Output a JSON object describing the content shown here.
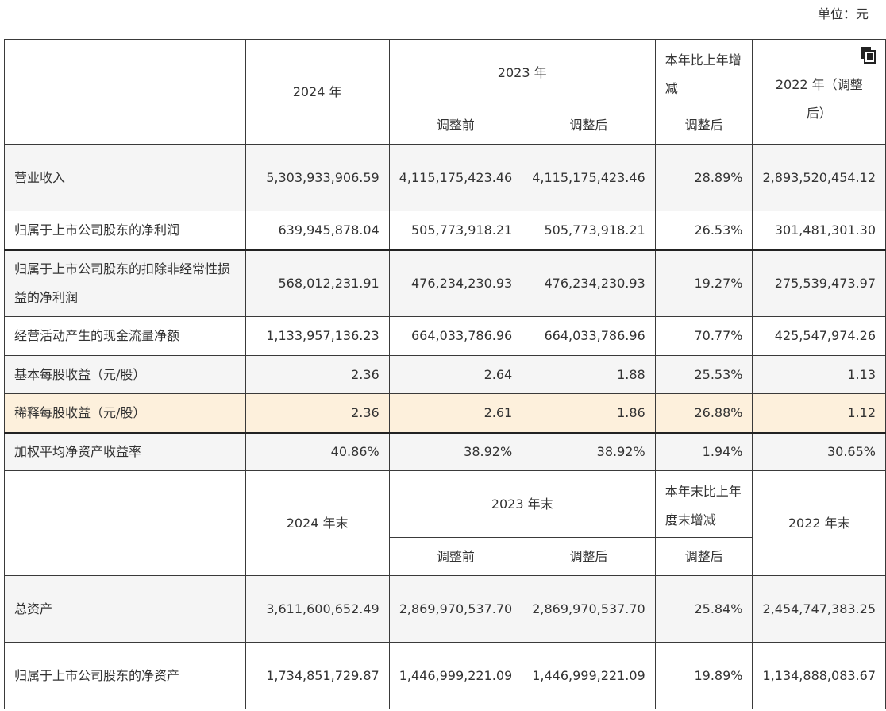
{
  "unit_label": "单位：元",
  "header1": {
    "col1": "2024 年",
    "col2": "2023 年",
    "col2a": "调整前",
    "col2b": "调整后",
    "col3": "本年比上年增减",
    "col3a": "调整后",
    "col4": "2022 年（调整后）"
  },
  "rows1": [
    {
      "label": "营业收入",
      "v2024": "5,303,933,906.59",
      "v2023_before": "4,115,175,423.46",
      "v2023_after": "4,115,175,423.46",
      "change": "28.89%",
      "v2022": "2,893,520,454.12"
    },
    {
      "label": "归属于上市公司股东的净利润",
      "v2024": "639,945,878.04",
      "v2023_before": "505,773,918.21",
      "v2023_after": "505,773,918.21",
      "change": "26.53%",
      "v2022": "301,481,301.30"
    },
    {
      "label": "归属于上市公司股东的扣除非经常性损益的净利润",
      "v2024": "568,012,231.91",
      "v2023_before": "476,234,230.93",
      "v2023_after": "476,234,230.93",
      "change": "19.27%",
      "v2022": "275,539,473.97"
    },
    {
      "label": "经营活动产生的现金流量净额",
      "v2024": "1,133,957,136.23",
      "v2023_before": "664,033,786.96",
      "v2023_after": "664,033,786.96",
      "change": "70.77%",
      "v2022": "425,547,974.26"
    },
    {
      "label": "基本每股收益（元/股）",
      "v2024": "2.36",
      "v2023_before": "2.64",
      "v2023_after": "1.88",
      "change": "25.53%",
      "v2022": "1.13"
    },
    {
      "label": "稀释每股收益（元/股）",
      "v2024": "2.36",
      "v2023_before": "2.61",
      "v2023_after": "1.86",
      "change": "26.88%",
      "v2022": "1.12"
    },
    {
      "label": "加权平均净资产收益率",
      "v2024": "40.86%",
      "v2023_before": "38.92%",
      "v2023_after": "38.92%",
      "change": "1.94%",
      "v2022": "30.65%"
    }
  ],
  "header2": {
    "col1": "2024 年末",
    "col2": "2023 年末",
    "col2a": "调整前",
    "col2b": "调整后",
    "col3": "本年末比上年度末增减",
    "col3a": "调整后",
    "col4": "2022 年末"
  },
  "rows2": [
    {
      "label": "总资产",
      "v2024": "3,611,600,652.49",
      "v2023_before": "2,869,970,537.70",
      "v2023_after": "2,869,970,537.70",
      "change": "25.84%",
      "v2022": "2,454,747,383.25"
    },
    {
      "label": "归属于上市公司股东的净资产",
      "v2024": "1,734,851,729.87",
      "v2023_before": "1,446,999,221.09",
      "v2023_after": "1,446,999,221.09",
      "change": "19.89%",
      "v2022": "1,134,888,083.67"
    }
  ],
  "icons": {
    "copy": "copy-icon"
  }
}
